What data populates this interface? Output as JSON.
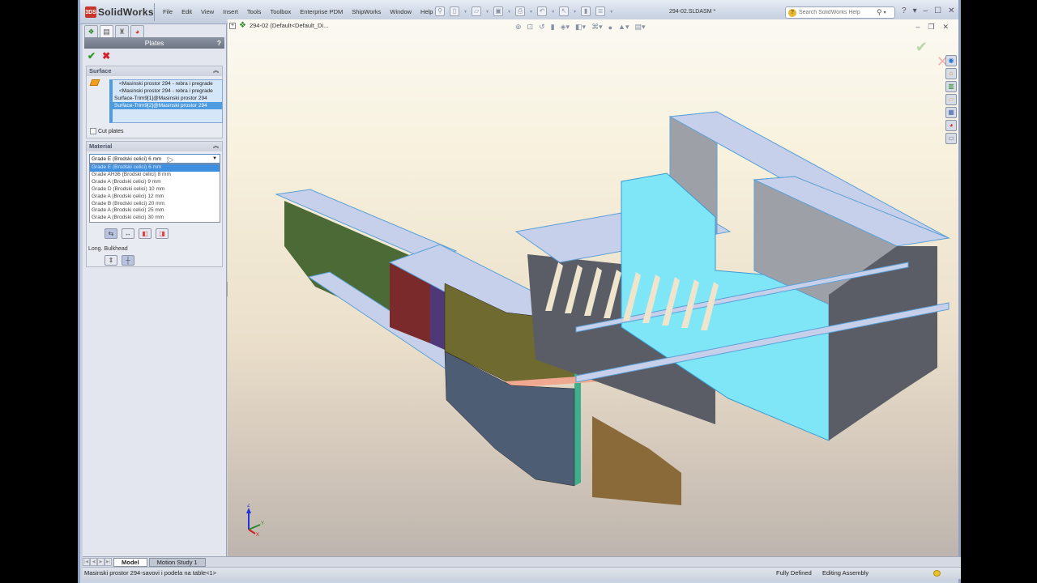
{
  "app": {
    "name": "SolidWorks",
    "logo_text": "3DS",
    "document_title": "294-02.SLDASM *"
  },
  "menu": [
    "File",
    "Edit",
    "View",
    "Insert",
    "Tools",
    "Toolbox",
    "Enterprise PDM",
    "ShipWorks",
    "Window",
    "Help"
  ],
  "quick_tools": [
    "pin-icon",
    "new-document-icon",
    "open-icon",
    "save-icon",
    "print-icon",
    "undo-icon",
    "select-icon",
    "rebuild-icon",
    "options-icon"
  ],
  "help_search": {
    "placeholder": "Search SolidWorks Help"
  },
  "window_controls": {
    "help": "?",
    "minimize": "–",
    "maximize": "☐",
    "close": "✕"
  },
  "panel": {
    "tabs": [
      "feature-manager-icon",
      "property-manager-icon",
      "configuration-manager-icon",
      "display-manager-icon"
    ],
    "title": "Plates",
    "help": "?",
    "ok": "✔",
    "cancel": "✖",
    "surface": {
      "header": "Surface",
      "items": [
        "<Masinski prostor 294 - rebra i pregrade",
        "<Masinski prostor 294 - rebra i pregrade",
        "Surface-Trim9[1]@Masinski prostor 294",
        "Surface-Trim9[2]@Masinski prostor 294"
      ],
      "selected_index": 3,
      "cut_plates_label": "Cut plates",
      "cut_plates_checked": false
    },
    "material": {
      "header": "Material",
      "selected": "Grade E (Brodski celici) 6 mm",
      "options": [
        "Grade E (Brodski celici) 6 mm",
        "Grade AH36 (Brodski celici) 8 mm",
        "Grade A (Brodski celici) 9 mm",
        "Grade D (Brodski celici) 10 mm",
        "Grade A (Brodski celici) 12 mm",
        "Grade B (Brodski celici) 20 mm",
        "Grade A (Brodski celici) 25 mm",
        "Grade A (Brodski celici) 30 mm"
      ],
      "highlighted_index": 0,
      "buttons": [
        "plate-both-sides-icon",
        "plate-offset-icon",
        "plate-side-a-icon",
        "plate-side-b-icon"
      ],
      "bulkhead_label": "Long. Bulkhead",
      "bulkhead_buttons": [
        "bulkhead-mirror-icon",
        "bulkhead-center-icon"
      ]
    }
  },
  "viewport": {
    "tree_item": "294-02  (Default<Default_Di...",
    "heads_up_tools": [
      "zoom-to-fit-icon",
      "zoom-area-icon",
      "previous-view-icon",
      "section-view-icon",
      "view-orientation-icon",
      "display-style-icon",
      "hide-show-icon",
      "edit-appearance-icon",
      "apply-scene-icon",
      "view-settings-icon"
    ],
    "task_pane": [
      "solidworks-resources-icon",
      "design-library-icon",
      "file-explorer-icon",
      "search-folder-icon",
      "view-palette-icon",
      "appearances-icon",
      "custom-properties-icon"
    ],
    "triad_axes": [
      "X",
      "Y",
      "Z"
    ]
  },
  "bottom_tabs": [
    "Model",
    "Motion Study 1"
  ],
  "active_bottom_tab": "Model",
  "status": {
    "text": "Masinski prostor 294-savovi i podela na table<1>",
    "defined": "Fully Defined",
    "mode": "Editing Assembly"
  },
  "colors": {
    "plate_top": "#c7d0ea",
    "plate_edge": "#5aa0d6",
    "cyan_selected": "#7fe6f7",
    "gray_frame": "#5a5d66",
    "olive": "#6f6a2f",
    "green": "#4b6a35",
    "red": "#7b2a2c",
    "purple": "#4f3878",
    "steel_blue": "#4d5e74",
    "teal": "#3fae8d",
    "salmon": "#f0a890",
    "brown": "#8b6a3a"
  }
}
